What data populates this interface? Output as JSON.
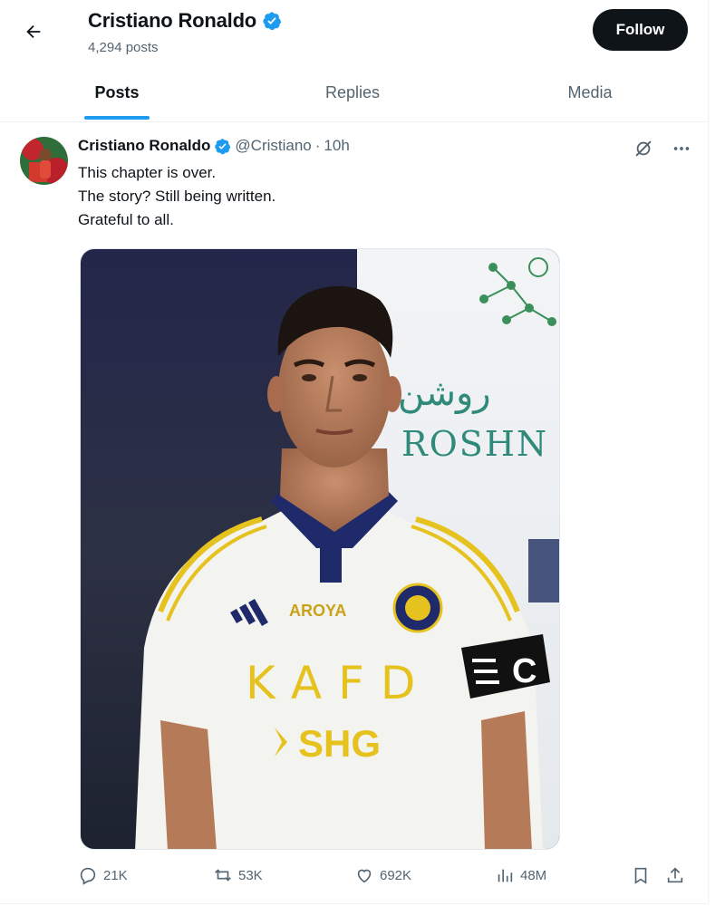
{
  "header": {
    "name": "Cristiano Ronaldo",
    "post_count": "4,294 posts",
    "follow_label": "Follow"
  },
  "tabs": [
    {
      "label": "Posts",
      "active": true
    },
    {
      "label": "Replies",
      "active": false
    },
    {
      "label": "Media",
      "active": false
    }
  ],
  "tweet": {
    "author_name": "Cristiano Ronaldo",
    "handle": "@Cristiano",
    "separator": "·",
    "time": "10h",
    "lines": [
      "This chapter is over.",
      "The story? Still being written.",
      "Grateful to all."
    ],
    "media": {
      "jersey_sponsor_top": "AROYA",
      "jersey_sponsor_main": "KAFD",
      "jersey_sponsor_sub": "SHG",
      "captain_band": "C",
      "backdrop_arabic": "روشن",
      "backdrop_text": "ROSHN"
    },
    "stats": {
      "replies": "21K",
      "reposts": "53K",
      "likes": "692K",
      "views": "48M"
    }
  },
  "colors": {
    "accent": "#1d9bf0",
    "text": "#0f1419",
    "muted": "#536471",
    "button_bg": "#0f1419"
  },
  "icons": [
    "back-arrow-icon",
    "verified-badge-icon",
    "grok-icon",
    "more-icon",
    "reply-icon",
    "repost-icon",
    "like-icon",
    "views-icon",
    "bookmark-icon",
    "share-icon"
  ]
}
